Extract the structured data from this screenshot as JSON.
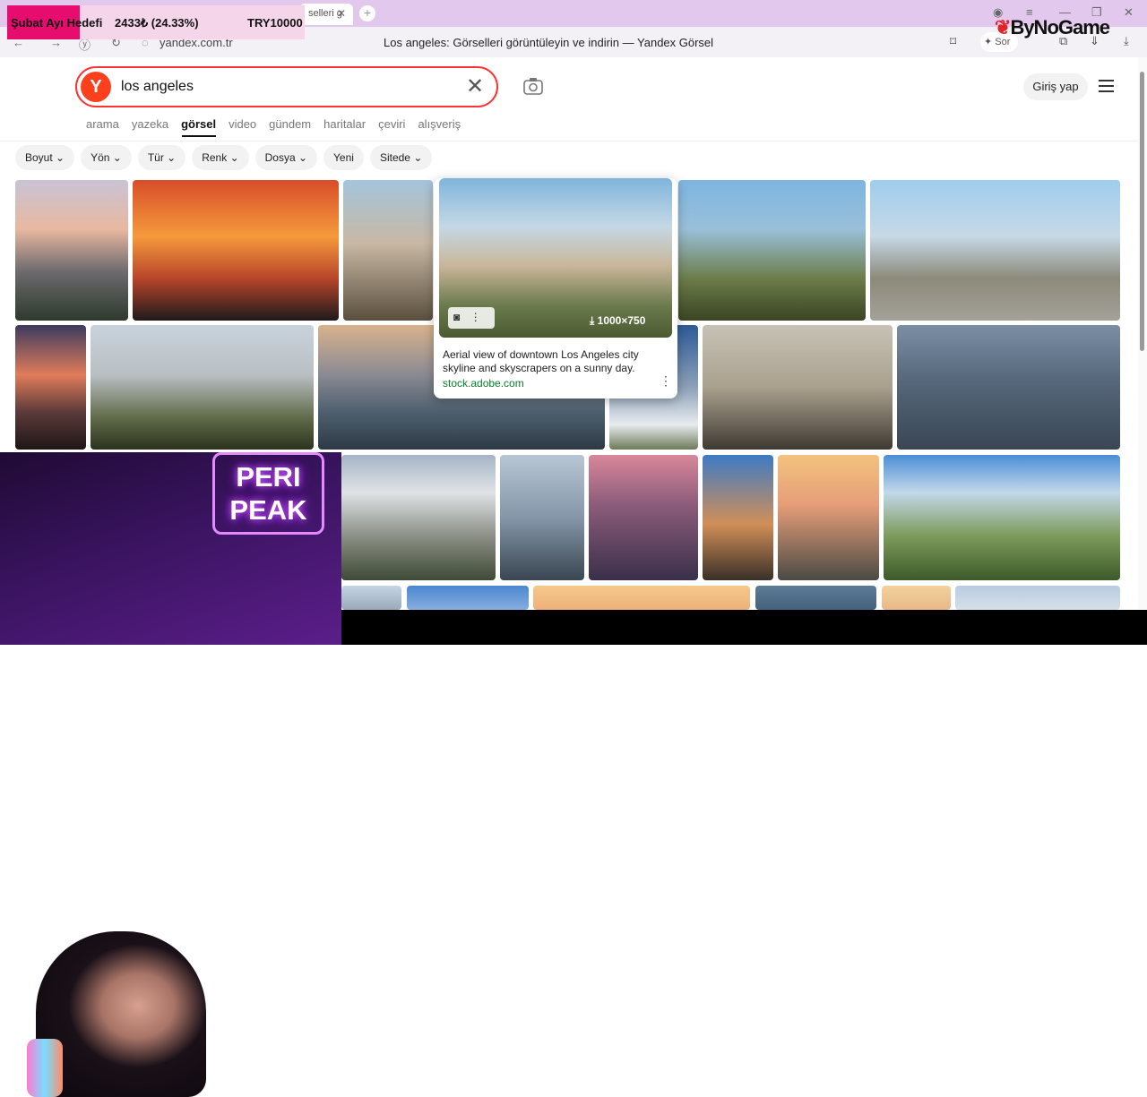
{
  "stream_overlay": {
    "goal_label": "Şubat Ayı Hedefi",
    "progress_text": "2433₺ (24.33%)",
    "target_text": "TRY10000",
    "progress_fraction": 0.2433,
    "brand_name": "ByNoGame"
  },
  "browser": {
    "tab_title": "selleri g",
    "url": "yandex.com.tr",
    "page_title": "Los angeles: Görselleri görüntüleyin ve indirin — Yandex Görsel",
    "sor_label": "Sor"
  },
  "search": {
    "logo_letter": "Y",
    "query": "los angeles",
    "login_label": "Giriş yap"
  },
  "services": [
    {
      "label": "arama",
      "active": false
    },
    {
      "label": "yazeka",
      "active": false
    },
    {
      "label": "görsel",
      "active": true
    },
    {
      "label": "video",
      "active": false
    },
    {
      "label": "gündem",
      "active": false
    },
    {
      "label": "haritalar",
      "active": false
    },
    {
      "label": "çeviri",
      "active": false
    },
    {
      "label": "alışveriş",
      "active": false
    }
  ],
  "filters": [
    {
      "label": "Boyut",
      "dropdown": true
    },
    {
      "label": "Yön",
      "dropdown": true
    },
    {
      "label": "Tür",
      "dropdown": true
    },
    {
      "label": "Renk",
      "dropdown": true
    },
    {
      "label": "Dosya",
      "dropdown": true
    },
    {
      "label": "Yeni",
      "dropdown": false
    },
    {
      "label": "Sitede",
      "dropdown": true
    }
  ],
  "hover_card": {
    "size_label": "1000×750",
    "description": "Aerial view of downtown Los Angeles city skyline and skyscrapers on a sunny day.",
    "source": "stock.adobe.com"
  },
  "webcam": {
    "sign_line1": "PERI",
    "sign_line2": "PEAK"
  },
  "colors": {
    "search_border": "#ff3333",
    "yandex_red": "#fc3f1d",
    "source_green": "#0a7d28",
    "overlay_highlight": "#e60d6e"
  }
}
